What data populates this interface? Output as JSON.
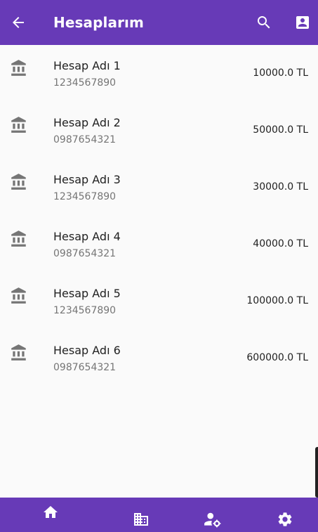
{
  "appbar": {
    "title": "Hesaplarım",
    "back_icon": "arrow-back-icon",
    "search_icon": "search-icon",
    "account_icon": "account-box-icon"
  },
  "accounts": [
    {
      "name": "Hesap Adı 1",
      "number": "1234567890",
      "amount": "10000.0 TL"
    },
    {
      "name": "Hesap Adı 2",
      "number": "0987654321",
      "amount": "50000.0 TL"
    },
    {
      "name": "Hesap Adı 3",
      "number": "1234567890",
      "amount": "30000.0 TL"
    },
    {
      "name": "Hesap Adı 4",
      "number": "0987654321",
      "amount": "40000.0 TL"
    },
    {
      "name": "Hesap Adı 5",
      "number": "1234567890",
      "amount": "100000.0 TL"
    },
    {
      "name": "Hesap Adı 6",
      "number": "0987654321",
      "amount": "600000.0 TL"
    }
  ],
  "bottom_nav": {
    "items": [
      "home-icon",
      "business-icon",
      "manage-accounts-icon",
      "settings-icon"
    ]
  },
  "colors": {
    "primary": "#673ab7",
    "icon_gray": "#757575",
    "text_primary": "#212121",
    "text_secondary": "#757575"
  }
}
